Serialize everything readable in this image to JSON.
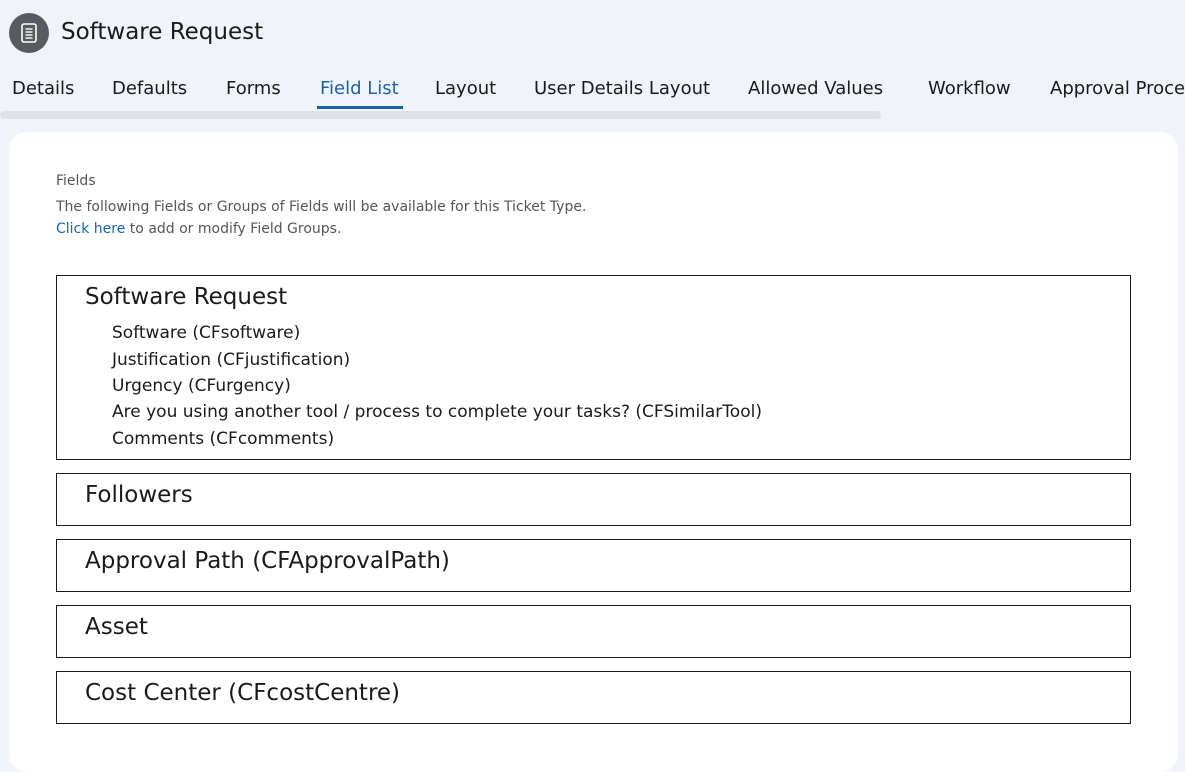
{
  "header": {
    "title": "Software Request",
    "icon": "form-icon"
  },
  "tabs": [
    {
      "label": "Details",
      "active": false
    },
    {
      "label": "Defaults",
      "active": false
    },
    {
      "label": "Forms",
      "active": false
    },
    {
      "label": "Field List",
      "active": true
    },
    {
      "label": "Layout",
      "active": false
    },
    {
      "label": "User Details Layout",
      "active": false
    },
    {
      "label": "Allowed Values",
      "active": false
    },
    {
      "label": "Workflow",
      "active": false
    },
    {
      "label": "Approval Proce",
      "active": false
    }
  ],
  "main": {
    "heading": "Fields",
    "description": "The following Fields or Groups of Fields will be available for this Ticket Type.",
    "link_text": "Click here",
    "link_suffix": " to add or modify Field Groups.",
    "groups": [
      {
        "title": "Software Request",
        "fields": [
          "Software (CFsoftware)",
          "Justification (CFjustification)",
          "Urgency (CFurgency)",
          "Are you using another tool / process to complete your tasks? (CFSimilarTool)",
          "Comments (CFcomments)"
        ]
      },
      {
        "title": "Followers",
        "fields": []
      },
      {
        "title": "Approval Path (CFApprovalPath)",
        "fields": []
      },
      {
        "title": "Asset",
        "fields": []
      },
      {
        "title": "Cost Center (CFcostCentre)",
        "fields": []
      }
    ]
  },
  "colors": {
    "accent": "#1b63a8",
    "page_bg": "#f0f3fa",
    "icon_bg": "#575a5e"
  }
}
